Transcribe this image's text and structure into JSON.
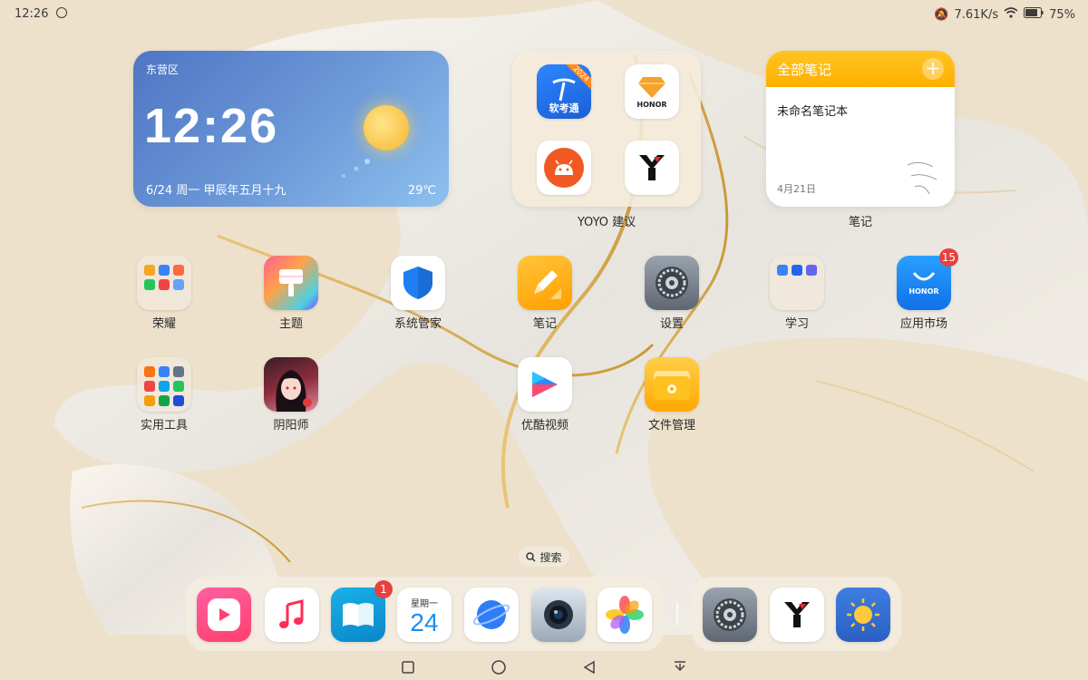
{
  "status_bar": {
    "time": "12:26",
    "speed": "7.61K/s",
    "battery": "75%"
  },
  "weather_widget": {
    "location": "东营区",
    "time": "12:26",
    "date": "6/24 周一 甲辰年五月十九",
    "temperature": "29℃"
  },
  "yoyo_widget": {
    "label": "YOYO 建议",
    "apps": [
      {
        "name": "软考通",
        "badge": "2024"
      },
      {
        "name": "HONOR"
      },
      {
        "name": "android-app"
      },
      {
        "name": "Y-app"
      }
    ]
  },
  "notes_widget": {
    "header": "全部笔记",
    "note_title": "未命名笔记本",
    "note_date": "4月21日",
    "label": "笔记"
  },
  "apps_row1": [
    {
      "label": "荣耀",
      "type": "folder"
    },
    {
      "label": "主题"
    },
    {
      "label": "系统管家"
    },
    {
      "label": "笔记"
    },
    {
      "label": "设置"
    },
    {
      "label": "学习",
      "type": "folder"
    },
    {
      "label": "应用市场",
      "badge": "15",
      "icon_text": "HONOR"
    }
  ],
  "apps_row2": [
    {
      "label": "实用工具",
      "type": "folder"
    },
    {
      "label": "阴阳师"
    },
    {
      "label": "优酷视频"
    },
    {
      "label": "文件管理"
    }
  ],
  "search": {
    "label": "搜索"
  },
  "dock": {
    "calendar": {
      "weekday": "星期一",
      "day": "24"
    },
    "books_badge": "1"
  },
  "colors": {
    "accent": "#ffb000",
    "badge": "#e84040",
    "honor_blue": "#1c8cf0"
  }
}
